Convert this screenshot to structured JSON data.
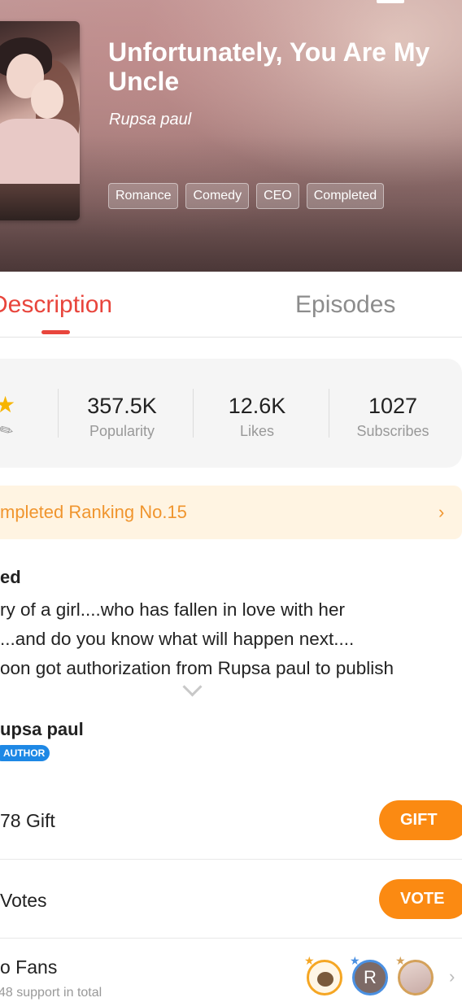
{
  "header": {
    "title": "Unfortunately, You Are My Uncle",
    "author": "Rupsa paul",
    "tags": [
      "Romance",
      "Comedy",
      "CEO",
      "Completed"
    ]
  },
  "tabs": [
    {
      "label": "Description",
      "active": true
    },
    {
      "label": "Episodes",
      "active": false
    }
  ],
  "stats": {
    "items": [
      {
        "value": "357.5K",
        "label": "Popularity"
      },
      {
        "value": "12.6K",
        "label": "Likes"
      },
      {
        "value": "1027",
        "label": "Subscribes"
      }
    ]
  },
  "ranking": {
    "text": "mpleted Ranking No.15"
  },
  "description": {
    "heading": "ed",
    "lines": [
      "ry of a girl....who has fallen in love with her",
      "...and do you know what will happen next....",
      "oon got authorization from Rupsa paul to publish"
    ]
  },
  "author_section": {
    "name": "upsa paul",
    "badge": "AUTHOR"
  },
  "gift": {
    "text": "78  Gift",
    "button": "GIFT"
  },
  "vote": {
    "text": " Votes",
    "button": "VOTE"
  },
  "fans": {
    "title": "o Fans",
    "subtitle": "48 support in total",
    "avatar_letter": "R"
  },
  "colors": {
    "accent_red": "#e8453c",
    "accent_orange": "#fb8a12",
    "ranking_bg": "#fff4e2",
    "ranking_text": "#f0952e",
    "author_badge": "#1e88e5"
  }
}
